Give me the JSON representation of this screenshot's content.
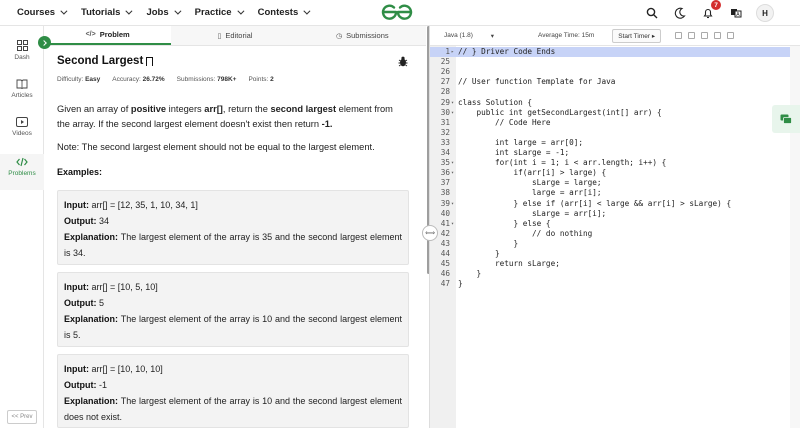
{
  "nav": {
    "items": [
      {
        "label": "Courses"
      },
      {
        "label": "Tutorials"
      },
      {
        "label": "Jobs"
      },
      {
        "label": "Practice"
      },
      {
        "label": "Contests"
      }
    ],
    "notification_count": "7",
    "avatar_initial": "H",
    "brand_color": "#2f8d46"
  },
  "sidebar": {
    "items": [
      {
        "label": "Dash",
        "icon": "grid-icon"
      },
      {
        "label": "Articles",
        "icon": "book-icon"
      },
      {
        "label": "Videos",
        "icon": "video-icon"
      },
      {
        "label": "Problems",
        "icon": "code-icon"
      }
    ],
    "prev_label": "<< Prev"
  },
  "tabs": [
    {
      "label": "Problem",
      "icon": "</>"
    },
    {
      "label": "Editorial",
      "icon": "▯"
    },
    {
      "label": "Submissions",
      "icon": "◷"
    }
  ],
  "problem": {
    "title": "Second Largest",
    "difficulty_label": "Difficulty:",
    "difficulty": "Easy",
    "accuracy_label": "Accuracy:",
    "accuracy": "26.72%",
    "submissions_label": "Submissions:",
    "submissions": "798K+",
    "points_label": "Points:",
    "points": "2",
    "desc_1": "Given an array of ",
    "desc_b1": "positive",
    "desc_2": " integers ",
    "desc_b2": "arr[]",
    "desc_3": ", return the ",
    "desc_b3": "second largest",
    "desc_4": " element from the array. If the second largest element doesn't exist then return ",
    "desc_b4": "-1.",
    "note": "Note: The second largest element should not be equal to the largest element.",
    "examples_heading": "Examples:",
    "input_label": "Input:",
    "output_label": "Output:",
    "explanation_label": "Explanation:",
    "examples": [
      {
        "input": "arr[] = [12, 35, 1, 10, 34, 1]",
        "output": "34",
        "explanation": "The largest element of the array is 35 and the second largest element is 34."
      },
      {
        "input": "arr[] = [10, 5, 10]",
        "output": "5",
        "explanation": "The largest element of the array is 10 and the second largest element is 5."
      },
      {
        "input": "arr[] = [10, 10, 10]",
        "output": "-1",
        "explanation": "The largest element of the array is 10 and the second largest element does not exist."
      }
    ]
  },
  "editor": {
    "language": "Java (1.8)",
    "average_time": "Average Time: 15m",
    "start_timer": "Start Timer",
    "lines": [
      {
        "n": "1",
        "text": "// } Driver Code Ends",
        "hl": true,
        "fold": "▸"
      },
      {
        "n": "25",
        "text": ""
      },
      {
        "n": "26",
        "text": ""
      },
      {
        "n": "27",
        "text": "// User function Template for Java"
      },
      {
        "n": "28",
        "text": ""
      },
      {
        "n": "29",
        "text": "class Solution {",
        "fold": "▾"
      },
      {
        "n": "30",
        "text": "    public int getSecondLargest(int[] arr) {",
        "fold": "▾"
      },
      {
        "n": "31",
        "text": "        // Code Here"
      },
      {
        "n": "32",
        "text": ""
      },
      {
        "n": "33",
        "text": "        int large = arr[0];"
      },
      {
        "n": "34",
        "text": "        int sLarge = -1;"
      },
      {
        "n": "35",
        "text": "        for(int i = 1; i < arr.length; i++) {",
        "fold": "▾"
      },
      {
        "n": "36",
        "text": "            if(arr[i] > large) {",
        "fold": "▾"
      },
      {
        "n": "37",
        "text": "                sLarge = large;"
      },
      {
        "n": "38",
        "text": "                large = arr[i];"
      },
      {
        "n": "39",
        "text": "            } else if (arr[i] < large && arr[i] > sLarge) {",
        "fold": "▾"
      },
      {
        "n": "40",
        "text": "                sLarge = arr[i];"
      },
      {
        "n": "41",
        "text": "            } else {",
        "fold": "▾"
      },
      {
        "n": "42",
        "text": "                // do nothing"
      },
      {
        "n": "43",
        "text": "            }"
      },
      {
        "n": "44",
        "text": "        }"
      },
      {
        "n": "45",
        "text": "        return sLarge;"
      },
      {
        "n": "46",
        "text": "    }"
      },
      {
        "n": "47",
        "text": "}"
      }
    ]
  }
}
